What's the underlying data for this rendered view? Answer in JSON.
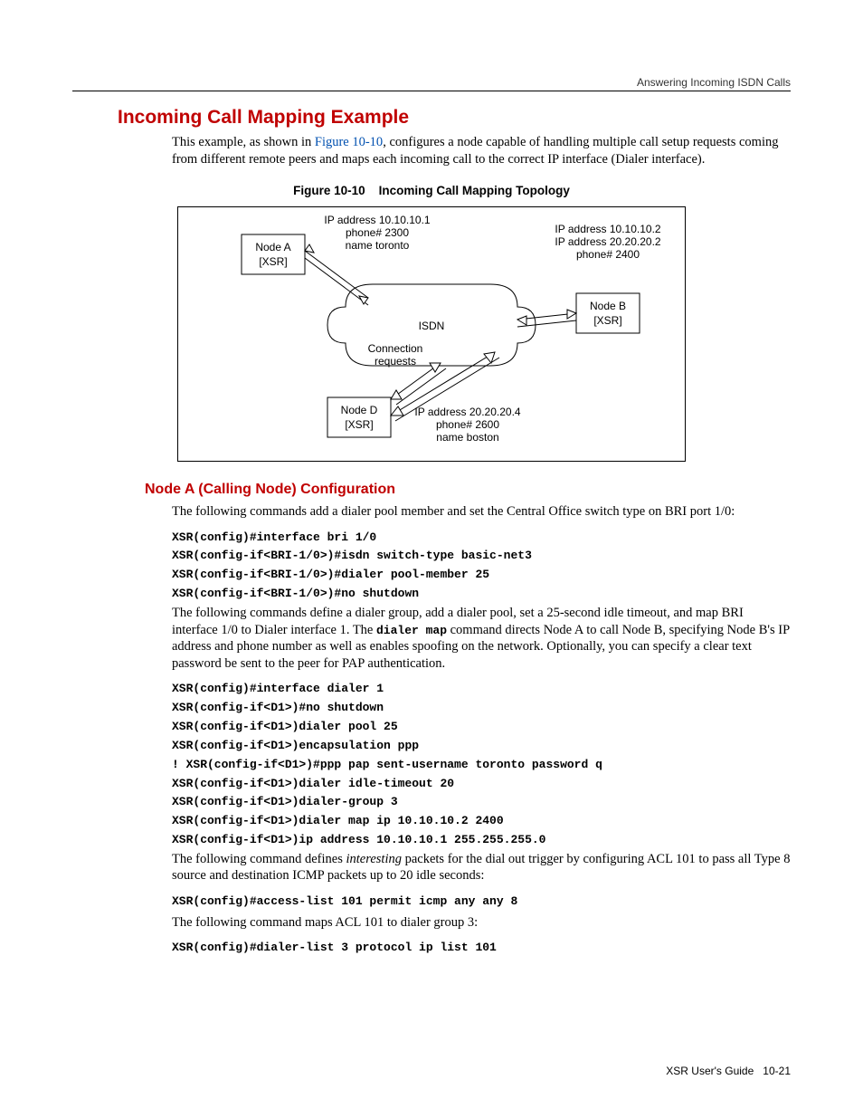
{
  "running_head": "Answering Incoming ISDN Calls",
  "h1": "Incoming Call Mapping Example",
  "intro_pre": "This example, as shown in ",
  "intro_link": "Figure 10-10",
  "intro_post": ", configures a node capable of handling multiple call setup requests coming from different remote peers and maps each incoming call to the correct IP interface (Dialer interface).",
  "fig_caption_label": "Figure 10-10",
  "fig_caption_title": "Incoming Call Mapping Topology",
  "diagram": {
    "nodeA": {
      "l1": "Node A",
      "l2": "[XSR]",
      "ip": "IP address 10.10.10.1",
      "phone": "phone# 2300",
      "name": "name toronto"
    },
    "nodeB": {
      "l1": "Node B",
      "l2": "[XSR]",
      "ip1": "IP address 10.10.10.2",
      "ip2": "IP address 20.20.20.2",
      "phone": "phone# 2400"
    },
    "nodeD": {
      "l1": "Node D",
      "l2": "[XSR]",
      "ip": "IP address 20.20.20.4",
      "phone": "phone# 2600",
      "name": "name boston"
    },
    "cloud": "ISDN",
    "conn1": "Connection",
    "conn2": "requests"
  },
  "h2": "Node A (Calling Node) Configuration",
  "para1": "The following commands add a dialer pool member and set the Central Office switch type on BRI port 1/0:",
  "code1": [
    "XSR(config)#interface bri 1/0",
    "XSR(config-if<BRI-1/0>)#isdn switch-type basic-net3",
    "XSR(config-if<BRI-1/0>)#dialer pool-member 25",
    "XSR(config-if<BRI-1/0>)#no shutdown"
  ],
  "para2_a": "The following commands define a dialer group, add a dialer pool, set a 25-second idle timeout, and map BRI interface 1/0 to Dialer interface 1. The ",
  "para2_code": "dialer map",
  "para2_b": " command directs Node A to call Node B, specifying Node B's IP address and phone number as well as enables spoofing on the network. Optionally, you can specify a clear text password be sent to the peer for PAP authentication.",
  "code2": [
    "XSR(config)#interface dialer 1",
    "XSR(config-if<D1>)#no shutdown",
    "XSR(config-if<D1>)dialer pool 25",
    "XSR(config-if<D1>)encapsulation ppp",
    "! XSR(config-if<D1>)#ppp pap sent-username toronto password q",
    "XSR(config-if<D1>)dialer idle-timeout 20",
    "XSR(config-if<D1>)dialer-group 3",
    "XSR(config-if<D1>)dialer map ip 10.10.10.2 2400",
    "XSR(config-if<D1>)ip address 10.10.10.1 255.255.255.0"
  ],
  "para3_a": "The following command defines ",
  "para3_i": "interesting",
  "para3_b": " packets for the dial out trigger by configuring ACL 101 to pass all Type 8 source and destination ICMP packets up to 20 idle seconds:",
  "code3": "XSR(config)#access-list 101 permit icmp any any 8",
  "para4": "The following command maps ACL 101 to dialer group 3:",
  "code4": "XSR(config)#dialer-list 3 protocol ip list 101",
  "footer_a": "XSR User's Guide",
  "footer_b": "10-21"
}
